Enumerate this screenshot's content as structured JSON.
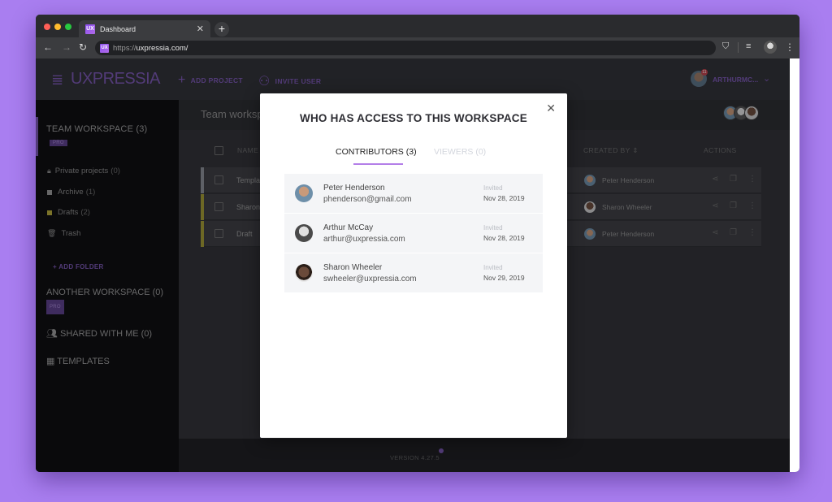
{
  "browser": {
    "tab_title": "Dashboard",
    "favicon_text": "UX",
    "url_scheme": "https://",
    "url_host": "uxpressia.com/",
    "icons": {
      "back": "arrow-left-icon",
      "forward": "arrow-right-icon",
      "reload": "reload-icon",
      "pocket": "pocket-icon",
      "media": "media-queue-icon",
      "menu": "kebab-menu-icon"
    }
  },
  "header": {
    "logo": "UXPRESSIA",
    "add_project": "ADD PROJECT",
    "invite_user": "INVITE USER",
    "username": "ARTHURMC...",
    "notification_count": "11",
    "accent": "#7a56b3"
  },
  "sidebar": {
    "workspace_title": "TEAM WORKSPACE (3)",
    "workspace_badge": "PRO",
    "items": [
      {
        "label": "Private projects",
        "count": "(0)",
        "icon": "lock-icon"
      },
      {
        "label": "Archive",
        "count": "(1)",
        "icon": "square-icon",
        "color": "#9a9a9a"
      },
      {
        "label": "Drafts",
        "count": "(2)",
        "icon": "square-icon",
        "color": "#b8ad3a"
      },
      {
        "label": "Trash",
        "count": "",
        "icon": "trash-icon"
      }
    ],
    "add_folder": "+ ADD FOLDER",
    "another_workspace": "ANOTHER WORKSPACE (0)",
    "another_badge": "PRO",
    "shared": "SHARED WITH ME (0)",
    "templates": "TEMPLATES"
  },
  "main": {
    "title": "Team workspace",
    "columns": {
      "name": "NAME",
      "created_by": "CREATED BY",
      "actions": "ACTIONS"
    },
    "rows": [
      {
        "name": "Template",
        "creator": "Peter Henderson",
        "color": "#8c9097"
      },
      {
        "name": "Sharon",
        "creator": "Sharon Wheeler",
        "color": "#a39b34"
      },
      {
        "name": "Draft",
        "creator": "Peter Henderson",
        "color": "#a39b34"
      }
    ],
    "version": "VERSION 4.27.5"
  },
  "modal": {
    "title": "WHO HAS ACCESS TO THIS WORKSPACE",
    "tabs": [
      {
        "label": "CONTRIBUTORS (3)",
        "active": true
      },
      {
        "label": "VIEWERS (0)",
        "active": false
      }
    ],
    "contributors": [
      {
        "name": "Peter Henderson",
        "email": "phenderson@gmail.com",
        "status": "Invited",
        "date": "Nov 28, 2019"
      },
      {
        "name": "Arthur McCay",
        "email": "arthur@uxpressia.com",
        "status": "Invited",
        "date": "Nov 28, 2019"
      },
      {
        "name": "Sharon Wheeler",
        "email": "swheeler@uxpressia.com",
        "status": "Invited",
        "date": "Nov 29, 2019"
      }
    ]
  }
}
